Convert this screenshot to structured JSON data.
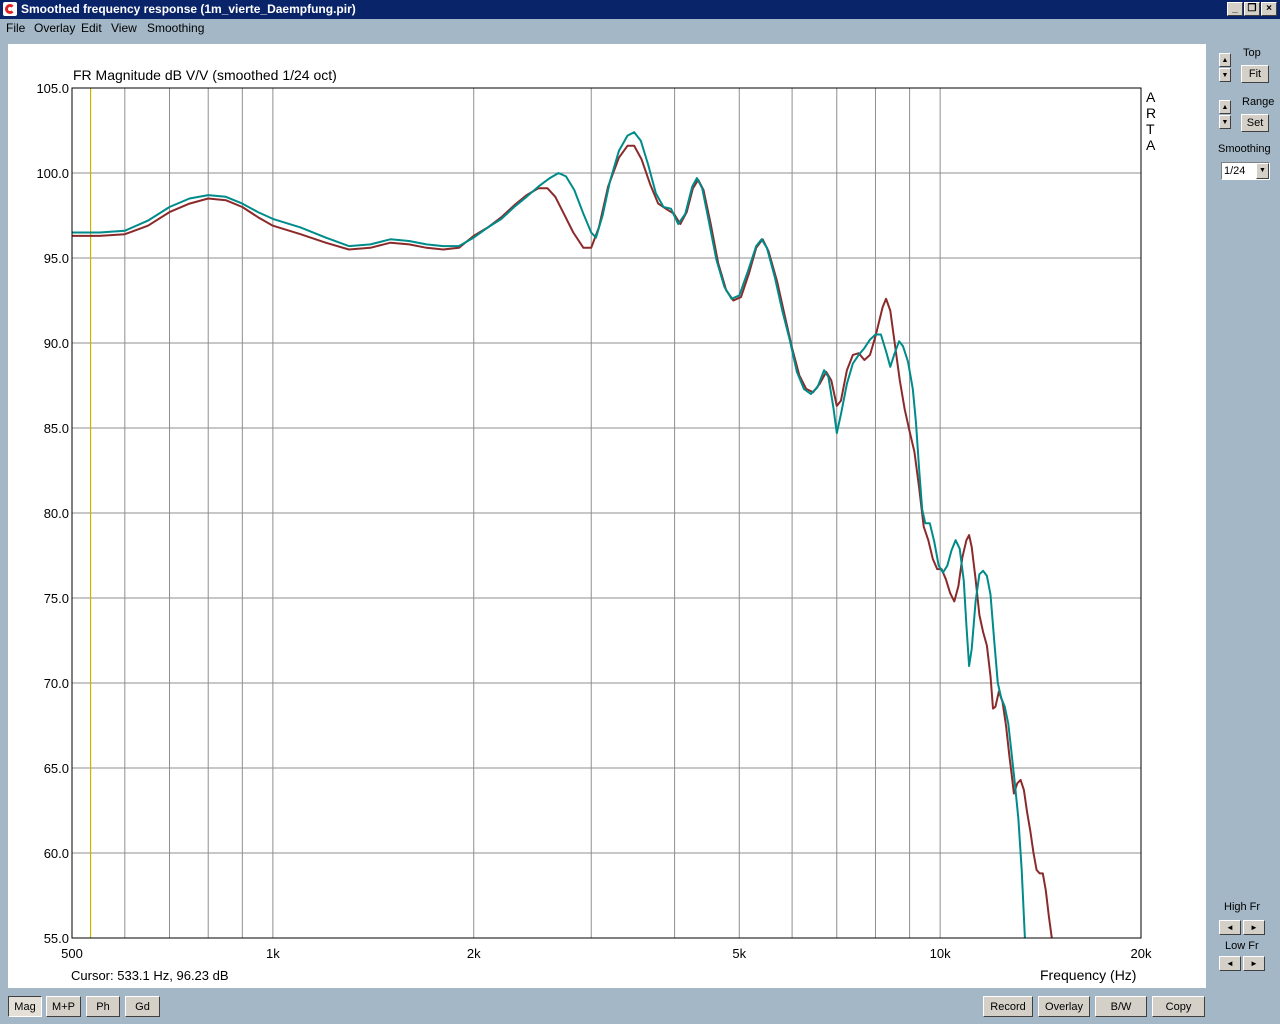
{
  "window": {
    "title": "Smoothed frequency response (1m_vierte_Daempfung.pir)",
    "minimize_glyph": "_",
    "restore_glyph": "❐",
    "close_glyph": "×"
  },
  "menu": [
    "File",
    "Overlay",
    "Edit",
    "View",
    "Smoothing"
  ],
  "plot": {
    "watermark": [
      "A",
      "R",
      "T",
      "A"
    ],
    "cursor_readout": "Cursor: 533.1 Hz, 96.23 dB"
  },
  "right_panel": {
    "top_label": "Top",
    "fit_label": "Fit",
    "range_label": "Range",
    "set_label": "Set",
    "smoothing_label": "Smoothing",
    "smoothing_value": "1/24",
    "high_fr_label": "High Fr",
    "low_fr_label": "Low Fr",
    "spin_up": "▲",
    "spin_down": "▼",
    "left_arrow": "◄",
    "right_arrow": "►"
  },
  "bottom_buttons": {
    "mag": "Mag",
    "mp": "M+P",
    "ph": "Ph",
    "gd": "Gd",
    "record": "Record",
    "overlay": "Overlay",
    "bw": "B/W",
    "copy": "Copy"
  },
  "colors": {
    "grid": "#8f8f8f",
    "frame": "#000000",
    "cursor_line": "#c8b400",
    "series_main": "#008b8b",
    "series_overlay": "#8b2a2a"
  },
  "chart_data": {
    "type": "line",
    "title": "FR Magnitude dB V/V (smoothed 1/24 oct)",
    "xlabel": "Frequency (Hz)",
    "ylabel": "",
    "x_scale": "log",
    "xlim": [
      500,
      20000
    ],
    "ylim": [
      55,
      105
    ],
    "x_ticks": [
      {
        "value": 500,
        "label": "500"
      },
      {
        "value": 1000,
        "label": "1k"
      },
      {
        "value": 2000,
        "label": "2k"
      },
      {
        "value": 5000,
        "label": "5k"
      },
      {
        "value": 10000,
        "label": "10k"
      },
      {
        "value": 20000,
        "label": "20k"
      }
    ],
    "x_minor": [
      600,
      700,
      800,
      900,
      3000,
      4000,
      6000,
      7000,
      8000,
      9000
    ],
    "y_ticks": [
      "55.0",
      "60.0",
      "65.0",
      "70.0",
      "75.0",
      "80.0",
      "85.0",
      "90.0",
      "95.0",
      "100.0",
      "105.0"
    ],
    "grid": true,
    "cursor_x": 533.1,
    "series": [
      {
        "color": "#008b8b",
        "points": [
          [
            500,
            96.5
          ],
          [
            550,
            96.5
          ],
          [
            600,
            96.6
          ],
          [
            650,
            97.2
          ],
          [
            700,
            98.0
          ],
          [
            750,
            98.5
          ],
          [
            800,
            98.7
          ],
          [
            850,
            98.6
          ],
          [
            900,
            98.2
          ],
          [
            950,
            97.7
          ],
          [
            1000,
            97.3
          ],
          [
            1100,
            96.8
          ],
          [
            1200,
            96.2
          ],
          [
            1300,
            95.7
          ],
          [
            1400,
            95.8
          ],
          [
            1500,
            96.1
          ],
          [
            1600,
            96.0
          ],
          [
            1700,
            95.8
          ],
          [
            1800,
            95.7
          ],
          [
            1900,
            95.7
          ],
          [
            2000,
            96.2
          ],
          [
            2100,
            96.8
          ],
          [
            2200,
            97.3
          ],
          [
            2300,
            98.0
          ],
          [
            2400,
            98.6
          ],
          [
            2500,
            99.2
          ],
          [
            2600,
            99.7
          ],
          [
            2680,
            100.0
          ],
          [
            2750,
            99.8
          ],
          [
            2830,
            99.0
          ],
          [
            2920,
            97.6
          ],
          [
            3000,
            96.5
          ],
          [
            3050,
            96.2
          ],
          [
            3120,
            97.5
          ],
          [
            3200,
            99.5
          ],
          [
            3300,
            101.3
          ],
          [
            3400,
            102.2
          ],
          [
            3480,
            102.4
          ],
          [
            3560,
            101.9
          ],
          [
            3650,
            100.5
          ],
          [
            3750,
            98.8
          ],
          [
            3850,
            98.0
          ],
          [
            3950,
            97.9
          ],
          [
            4050,
            97.0
          ],
          [
            4150,
            97.6
          ],
          [
            4250,
            99.2
          ],
          [
            4320,
            99.7
          ],
          [
            4400,
            99.1
          ],
          [
            4500,
            97.2
          ],
          [
            4620,
            94.9
          ],
          [
            4750,
            93.3
          ],
          [
            4870,
            92.6
          ],
          [
            5000,
            92.8
          ],
          [
            5150,
            94.2
          ],
          [
            5300,
            95.7
          ],
          [
            5400,
            96.1
          ],
          [
            5500,
            95.6
          ],
          [
            5650,
            93.9
          ],
          [
            5800,
            91.9
          ],
          [
            5950,
            90.2
          ],
          [
            6100,
            88.3
          ],
          [
            6250,
            87.3
          ],
          [
            6400,
            87.0
          ],
          [
            6550,
            87.4
          ],
          [
            6700,
            88.4
          ],
          [
            6800,
            88.0
          ],
          [
            6920,
            86.2
          ],
          [
            7000,
            84.7
          ],
          [
            7100,
            85.8
          ],
          [
            7250,
            87.6
          ],
          [
            7400,
            88.8
          ],
          [
            7550,
            89.3
          ],
          [
            7700,
            89.7
          ],
          [
            7850,
            90.2
          ],
          [
            8000,
            90.5
          ],
          [
            8150,
            90.5
          ],
          [
            8300,
            89.5
          ],
          [
            8420,
            88.6
          ],
          [
            8550,
            89.4
          ],
          [
            8680,
            90.1
          ],
          [
            8800,
            89.8
          ],
          [
            8950,
            88.9
          ],
          [
            9100,
            87.3
          ],
          [
            9200,
            85.3
          ],
          [
            9300,
            82.6
          ],
          [
            9400,
            80.2
          ],
          [
            9500,
            79.4
          ],
          [
            9650,
            79.4
          ],
          [
            9800,
            78.3
          ],
          [
            9950,
            76.9
          ],
          [
            10100,
            76.5
          ],
          [
            10250,
            76.9
          ],
          [
            10400,
            77.8
          ],
          [
            10550,
            78.4
          ],
          [
            10700,
            77.9
          ],
          [
            10850,
            76.0
          ],
          [
            10950,
            73.4
          ],
          [
            11050,
            71.0
          ],
          [
            11150,
            72.0
          ],
          [
            11300,
            74.8
          ],
          [
            11450,
            76.4
          ],
          [
            11600,
            76.6
          ],
          [
            11750,
            76.3
          ],
          [
            11900,
            75.2
          ],
          [
            12050,
            72.5
          ],
          [
            12200,
            70.0
          ],
          [
            12350,
            69.1
          ],
          [
            12500,
            68.6
          ],
          [
            12650,
            67.6
          ],
          [
            12800,
            65.8
          ],
          [
            12950,
            64.0
          ],
          [
            13100,
            62.0
          ],
          [
            13250,
            59.0
          ],
          [
            13400,
            55.0
          ]
        ]
      },
      {
        "color": "#8b2a2a",
        "points": [
          [
            500,
            96.3
          ],
          [
            550,
            96.3
          ],
          [
            600,
            96.4
          ],
          [
            650,
            96.9
          ],
          [
            700,
            97.7
          ],
          [
            750,
            98.2
          ],
          [
            800,
            98.5
          ],
          [
            850,
            98.4
          ],
          [
            900,
            98.0
          ],
          [
            950,
            97.4
          ],
          [
            1000,
            96.9
          ],
          [
            1100,
            96.4
          ],
          [
            1200,
            95.9
          ],
          [
            1300,
            95.5
          ],
          [
            1400,
            95.6
          ],
          [
            1500,
            95.9
          ],
          [
            1600,
            95.8
          ],
          [
            1700,
            95.6
          ],
          [
            1800,
            95.5
          ],
          [
            1900,
            95.6
          ],
          [
            2000,
            96.3
          ],
          [
            2100,
            96.8
          ],
          [
            2200,
            97.4
          ],
          [
            2300,
            98.1
          ],
          [
            2400,
            98.7
          ],
          [
            2500,
            99.1
          ],
          [
            2580,
            99.1
          ],
          [
            2650,
            98.6
          ],
          [
            2730,
            97.6
          ],
          [
            2820,
            96.5
          ],
          [
            2920,
            95.6
          ],
          [
            3000,
            95.6
          ],
          [
            3080,
            96.8
          ],
          [
            3180,
            99.2
          ],
          [
            3300,
            100.9
          ],
          [
            3400,
            101.6
          ],
          [
            3480,
            101.6
          ],
          [
            3570,
            100.8
          ],
          [
            3680,
            99.3
          ],
          [
            3780,
            98.2
          ],
          [
            3880,
            97.9
          ],
          [
            3990,
            97.6
          ],
          [
            4080,
            97.0
          ],
          [
            4170,
            97.7
          ],
          [
            4260,
            99.1
          ],
          [
            4340,
            99.6
          ],
          [
            4420,
            99.0
          ],
          [
            4530,
            97.0
          ],
          [
            4650,
            94.7
          ],
          [
            4780,
            93.1
          ],
          [
            4900,
            92.5
          ],
          [
            5030,
            92.7
          ],
          [
            5170,
            94.1
          ],
          [
            5300,
            95.6
          ],
          [
            5420,
            96.1
          ],
          [
            5530,
            95.4
          ],
          [
            5700,
            93.6
          ],
          [
            5850,
            91.6
          ],
          [
            6000,
            89.7
          ],
          [
            6150,
            88.1
          ],
          [
            6300,
            87.3
          ],
          [
            6450,
            87.1
          ],
          [
            6600,
            87.6
          ],
          [
            6750,
            88.3
          ],
          [
            6870,
            87.8
          ],
          [
            7000,
            86.3
          ],
          [
            7100,
            86.6
          ],
          [
            7250,
            88.4
          ],
          [
            7400,
            89.3
          ],
          [
            7550,
            89.4
          ],
          [
            7700,
            89.0
          ],
          [
            7850,
            89.3
          ],
          [
            8000,
            90.4
          ],
          [
            8200,
            92.1
          ],
          [
            8300,
            92.6
          ],
          [
            8420,
            91.9
          ],
          [
            8550,
            90.0
          ],
          [
            8700,
            87.8
          ],
          [
            8850,
            86.1
          ],
          [
            9000,
            84.8
          ],
          [
            9150,
            83.6
          ],
          [
            9300,
            81.5
          ],
          [
            9450,
            79.2
          ],
          [
            9600,
            78.4
          ],
          [
            9750,
            77.3
          ],
          [
            9900,
            76.7
          ],
          [
            10050,
            76.7
          ],
          [
            10200,
            76.1
          ],
          [
            10350,
            75.3
          ],
          [
            10500,
            74.8
          ],
          [
            10650,
            75.7
          ],
          [
            10800,
            77.4
          ],
          [
            10950,
            78.4
          ],
          [
            11050,
            78.7
          ],
          [
            11150,
            78.0
          ],
          [
            11300,
            76.1
          ],
          [
            11450,
            74.0
          ],
          [
            11600,
            73.0
          ],
          [
            11750,
            72.2
          ],
          [
            11900,
            70.4
          ],
          [
            12000,
            68.5
          ],
          [
            12100,
            68.6
          ],
          [
            12250,
            69.5
          ],
          [
            12400,
            68.9
          ],
          [
            12550,
            67.5
          ],
          [
            12700,
            65.7
          ],
          [
            12800,
            64.6
          ],
          [
            12900,
            63.5
          ],
          [
            13050,
            64.1
          ],
          [
            13200,
            64.3
          ],
          [
            13350,
            63.7
          ],
          [
            13500,
            62.4
          ],
          [
            13650,
            61.3
          ],
          [
            13800,
            60.0
          ],
          [
            13950,
            59.0
          ],
          [
            14100,
            58.8
          ],
          [
            14250,
            58.8
          ],
          [
            14400,
            57.8
          ],
          [
            14550,
            56.3
          ],
          [
            14700,
            55.0
          ]
        ]
      }
    ]
  }
}
